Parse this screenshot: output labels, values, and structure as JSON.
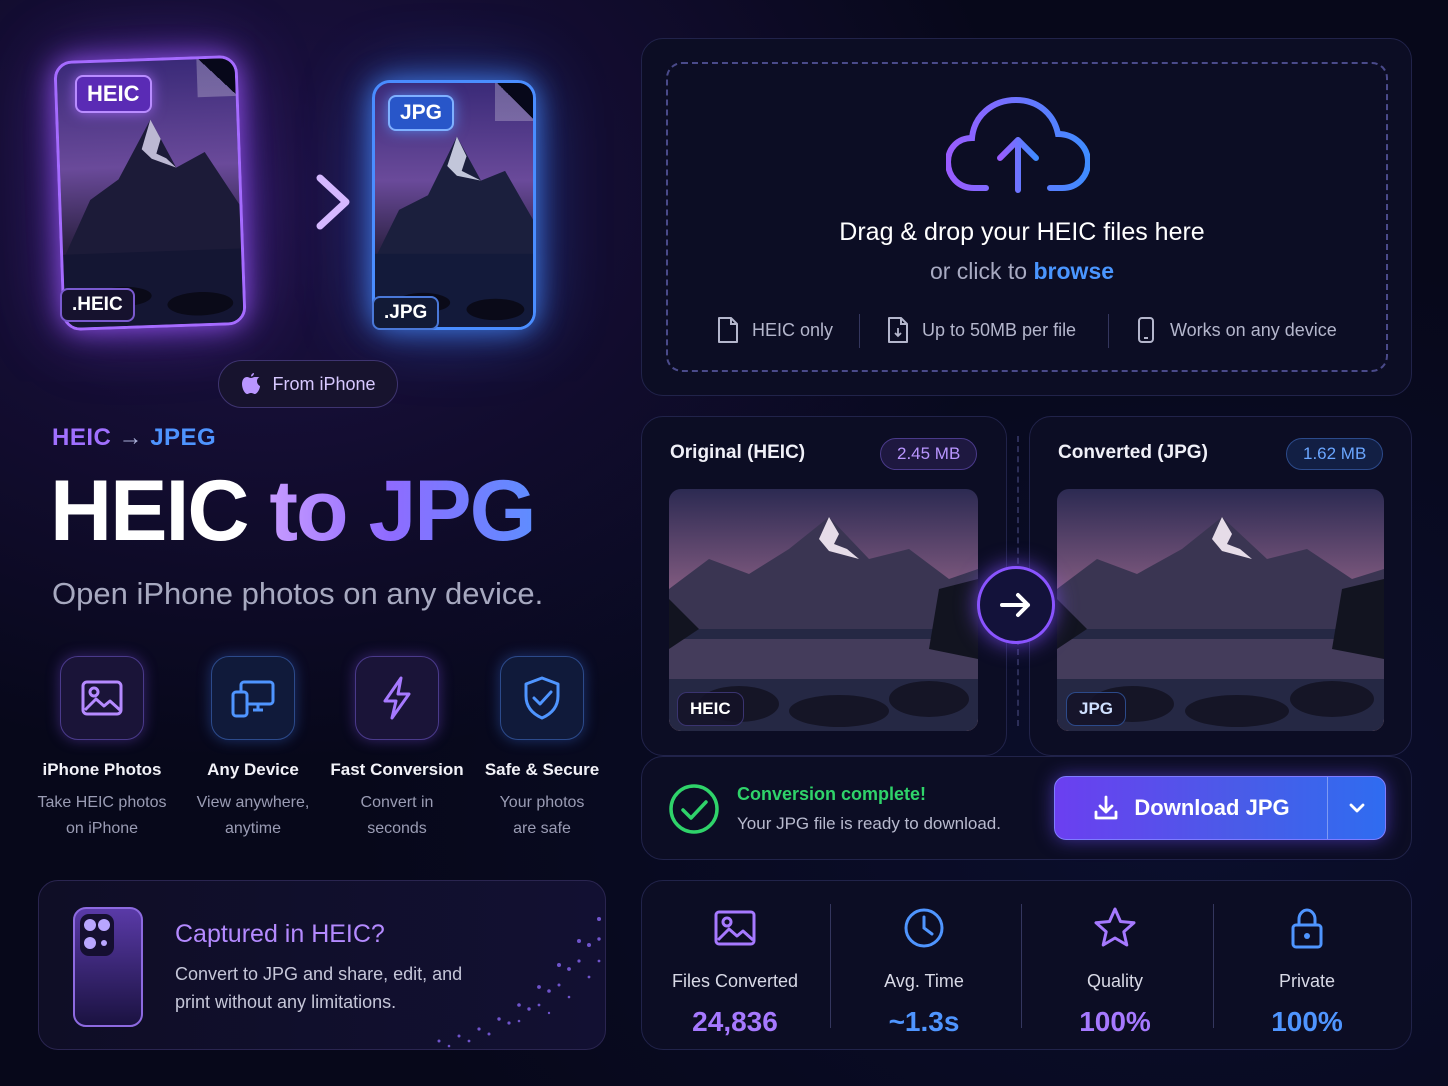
{
  "hero": {
    "heic_badge": "HEIC",
    "jpg_badge": "JPG",
    "heic_ext": ".HEIC",
    "jpg_ext": ".JPG",
    "from_iphone": "From iPhone",
    "kicker_from": "HEIC",
    "kicker_arrow": "→",
    "kicker_to": "JPEG",
    "title_white": "HEIC",
    "title_gradient": "to JPG",
    "subtitle": "Open iPhone photos on any device."
  },
  "features": [
    {
      "icon": "image-icon",
      "title": "iPhone Photos",
      "line1": "Take HEIC photos",
      "line2": "on iPhone"
    },
    {
      "icon": "devices-icon",
      "title": "Any Device",
      "line1": "View anywhere,",
      "line2": "anytime"
    },
    {
      "icon": "lightning-icon",
      "title": "Fast Conversion",
      "line1": "Convert in",
      "line2": "seconds"
    },
    {
      "icon": "shield-check-icon",
      "title": "Safe & Secure",
      "line1": "Your photos",
      "line2": "are safe"
    }
  ],
  "captured": {
    "title": "Captured in HEIC?",
    "text": "Convert to JPG and share, edit, and print without any limitations."
  },
  "dropzone": {
    "title": "Drag & drop your HEIC files here",
    "sub_prefix": "or click to",
    "sub_link": "browse",
    "meta": [
      "HEIC only",
      "Up to 50MB per file",
      "Works on any device"
    ]
  },
  "compare": {
    "original_label": "Original (HEIC)",
    "original_size": "2.45 MB",
    "original_tag": "HEIC",
    "converted_label": "Converted (JPG)",
    "converted_size": "1.62 MB",
    "converted_tag": "JPG"
  },
  "status": {
    "title": "Conversion complete!",
    "text": "Your JPG file is ready to download."
  },
  "download": {
    "label": "Download JPG"
  },
  "stats": [
    {
      "icon": "image-icon",
      "label": "Files Converted",
      "value": "24,836"
    },
    {
      "icon": "clock-icon",
      "label": "Avg. Time",
      "value": "~1.3s"
    },
    {
      "icon": "star-icon",
      "label": "Quality",
      "value": "100%"
    },
    {
      "icon": "lock-icon",
      "label": "Private",
      "value": "100%"
    }
  ],
  "colors": {
    "purple": "#8f5bff",
    "blue": "#3f8cff",
    "success": "#2fd36a",
    "background": "#07081a"
  }
}
